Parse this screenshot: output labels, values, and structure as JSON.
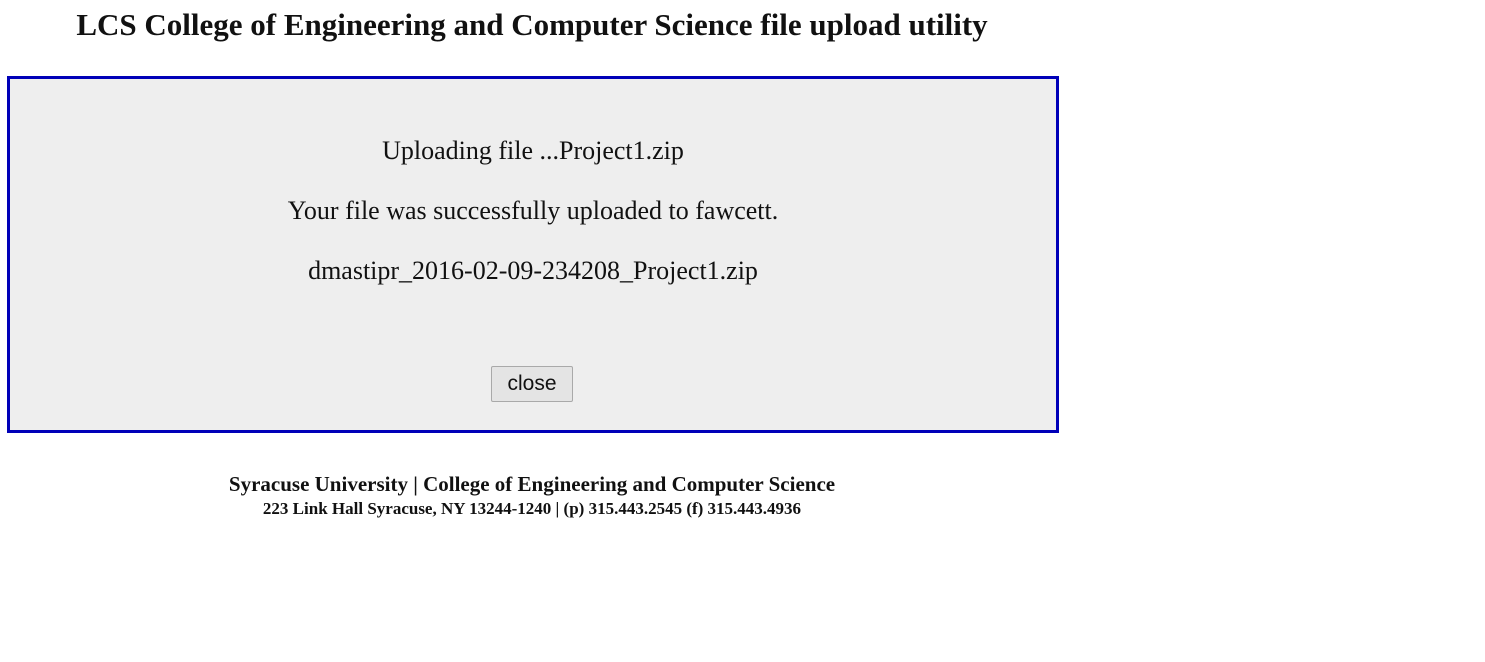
{
  "header": {
    "title": "LCS College of Engineering and Computer Science file upload utility"
  },
  "panel": {
    "uploading_text": "Uploading file ...Project1.zip",
    "success_text": "Your file was successfully uploaded to fawcett.",
    "filename": "dmastipr_2016-02-09-234208_Project1.zip",
    "close_label": "close"
  },
  "footer": {
    "line1": "Syracuse University | College of Engineering and Computer Science",
    "line2": "223 Link Hall Syracuse, NY 13244-1240 | (p) 315.443.2545 (f) 315.443.4936"
  },
  "colors": {
    "panel_border": "#0000b8",
    "panel_background": "#eeeeee"
  }
}
